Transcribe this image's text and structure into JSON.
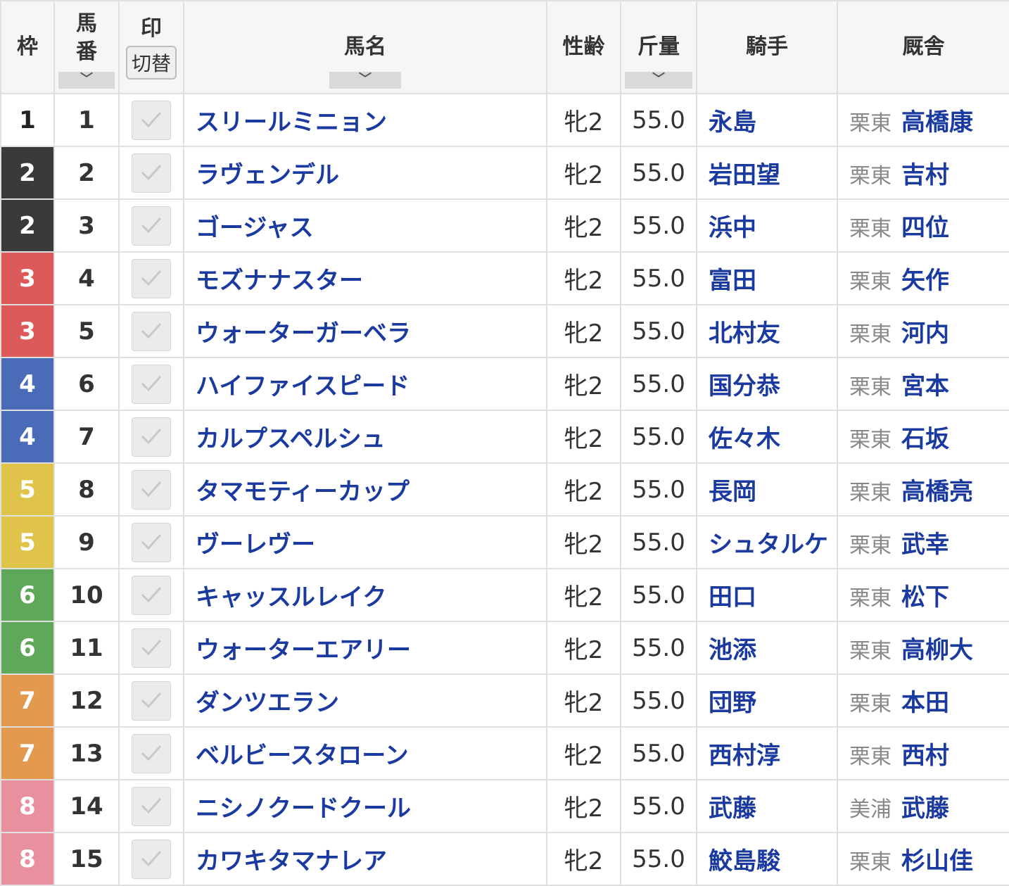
{
  "headers": {
    "waku": "枠",
    "umaban": "馬\n番",
    "mark": "印",
    "mark_switch": "切替",
    "horse_name": "馬名",
    "sex_age": "性齢",
    "weight": "斤量",
    "jockey": "騎手",
    "stable": "厩舎",
    "sort_icon": "chevron-down-icon",
    "sort_glyph": "﹀"
  },
  "colors": {
    "waku_1": "#ffffff",
    "waku_2": "#3a3a3a",
    "waku_3": "#dd5a5a",
    "waku_4": "#4a6bb8",
    "waku_5": "#e0c44a",
    "waku_6": "#5fa85a",
    "waku_7": "#e39a4e",
    "waku_8": "#e9909f",
    "link_blue": "#1a3aa0"
  },
  "rows": [
    {
      "waku": "1",
      "umaban": "1",
      "horse": "スリールミニョン",
      "sex_age": "牝2",
      "weight": "55.0",
      "jockey": "永島",
      "region": "栗東",
      "trainer": "高橋康"
    },
    {
      "waku": "2",
      "umaban": "2",
      "horse": "ラヴェンデル",
      "sex_age": "牝2",
      "weight": "55.0",
      "jockey": "岩田望",
      "region": "栗東",
      "trainer": "吉村"
    },
    {
      "waku": "2",
      "umaban": "3",
      "horse": "ゴージャス",
      "sex_age": "牝2",
      "weight": "55.0",
      "jockey": "浜中",
      "region": "栗東",
      "trainer": "四位"
    },
    {
      "waku": "3",
      "umaban": "4",
      "horse": "モズナナスター",
      "sex_age": "牝2",
      "weight": "55.0",
      "jockey": "富田",
      "region": "栗東",
      "trainer": "矢作"
    },
    {
      "waku": "3",
      "umaban": "5",
      "horse": "ウォーターガーベラ",
      "sex_age": "牝2",
      "weight": "55.0",
      "jockey": "北村友",
      "region": "栗東",
      "trainer": "河内"
    },
    {
      "waku": "4",
      "umaban": "6",
      "horse": "ハイファイスピード",
      "sex_age": "牝2",
      "weight": "55.0",
      "jockey": "国分恭",
      "region": "栗東",
      "trainer": "宮本"
    },
    {
      "waku": "4",
      "umaban": "7",
      "horse": "カルプスペルシュ",
      "sex_age": "牝2",
      "weight": "55.0",
      "jockey": "佐々木",
      "region": "栗東",
      "trainer": "石坂"
    },
    {
      "waku": "5",
      "umaban": "8",
      "horse": "タマモティーカップ",
      "sex_age": "牝2",
      "weight": "55.0",
      "jockey": "長岡",
      "region": "栗東",
      "trainer": "高橋亮"
    },
    {
      "waku": "5",
      "umaban": "9",
      "horse": "ヴーレヴー",
      "sex_age": "牝2",
      "weight": "55.0",
      "jockey": "シュタルケ",
      "region": "栗東",
      "trainer": "武幸"
    },
    {
      "waku": "6",
      "umaban": "10",
      "horse": "キャッスルレイク",
      "sex_age": "牝2",
      "weight": "55.0",
      "jockey": "田口",
      "region": "栗東",
      "trainer": "松下"
    },
    {
      "waku": "6",
      "umaban": "11",
      "horse": "ウォーターエアリー",
      "sex_age": "牝2",
      "weight": "55.0",
      "jockey": "池添",
      "region": "栗東",
      "trainer": "高柳大"
    },
    {
      "waku": "7",
      "umaban": "12",
      "horse": "ダンツエラン",
      "sex_age": "牝2",
      "weight": "55.0",
      "jockey": "団野",
      "region": "栗東",
      "trainer": "本田"
    },
    {
      "waku": "7",
      "umaban": "13",
      "horse": "ベルビースタローン",
      "sex_age": "牝2",
      "weight": "55.0",
      "jockey": "西村淳",
      "region": "栗東",
      "trainer": "西村"
    },
    {
      "waku": "8",
      "umaban": "14",
      "horse": "ニシノクードクール",
      "sex_age": "牝2",
      "weight": "55.0",
      "jockey": "武藤",
      "region": "美浦",
      "trainer": "武藤"
    },
    {
      "waku": "8",
      "umaban": "15",
      "horse": "カワキタマナレア",
      "sex_age": "牝2",
      "weight": "55.0",
      "jockey": "鮫島駿",
      "region": "栗東",
      "trainer": "杉山佳"
    }
  ]
}
